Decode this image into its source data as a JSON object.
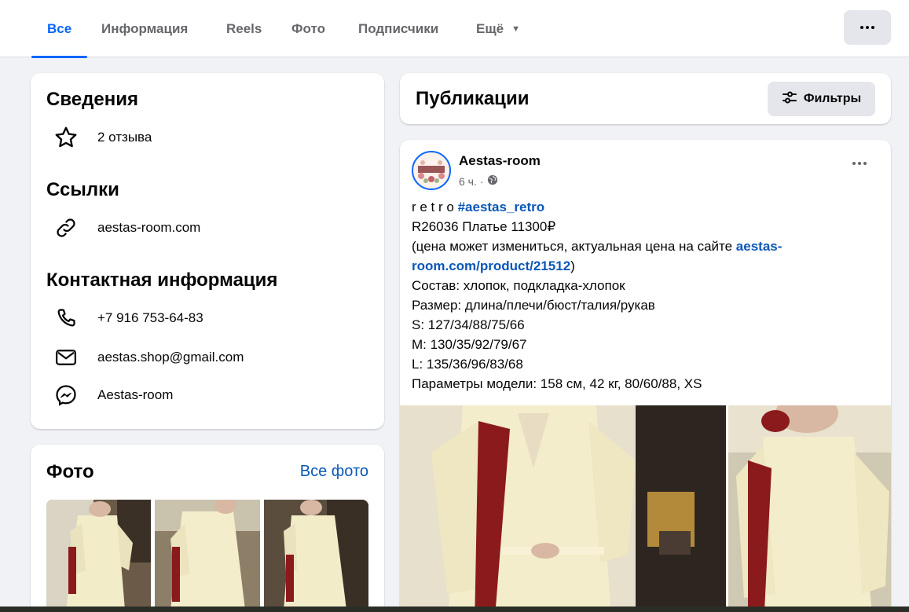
{
  "nav": {
    "tabs": [
      {
        "label": "Все",
        "active": true
      },
      {
        "label": "Информация"
      },
      {
        "label": "Reels"
      },
      {
        "label": "Фото"
      },
      {
        "label": "Подписчики"
      },
      {
        "label": "Ещё"
      }
    ],
    "more_icon": "ellipsis-icon"
  },
  "details": {
    "title": "Сведения",
    "reviews": "2 отзыва",
    "links_title": "Ссылки",
    "website": "aestas-room.com",
    "contact_title": "Контактная информация",
    "phone": "+7 916 753-64-83",
    "email": "aestas.shop@gmail.com",
    "messenger": "Aestas-room"
  },
  "photos": {
    "title": "Фото",
    "all_link": "Все фото"
  },
  "publications": {
    "title": "Публикации",
    "filters_label": "Фильтры"
  },
  "post": {
    "author": "Aestas-room",
    "avatar_text": "AESTAS ROOM",
    "time": "6 ч.",
    "separator": "·",
    "text_prefix": "r e t r o ",
    "hashtag": "#aestas_retro",
    "line2": "R26036 Платье 11300₽",
    "line3_start": "(цена может измениться, актуальная цена на сайте ",
    "line3_link": "aestas-",
    "line4_link": "room.com/product/21512",
    "line4_end": ")",
    "line5": "Состав: хлопок, подкладка-хлопок",
    "line6": "Размер: длина/плечи/бюст/талия/рукав",
    "line7": "S: 127/34/88/75/66",
    "line8": "M: 130/35/92/79/67",
    "line9": "L: 135/36/96/83/68",
    "line10": "Параметры модели: 158 см, 42 кг, 80/60/88, XS"
  },
  "colors": {
    "accent": "#0866ff",
    "link": "#0b57b7",
    "background": "#f0f2f5"
  }
}
